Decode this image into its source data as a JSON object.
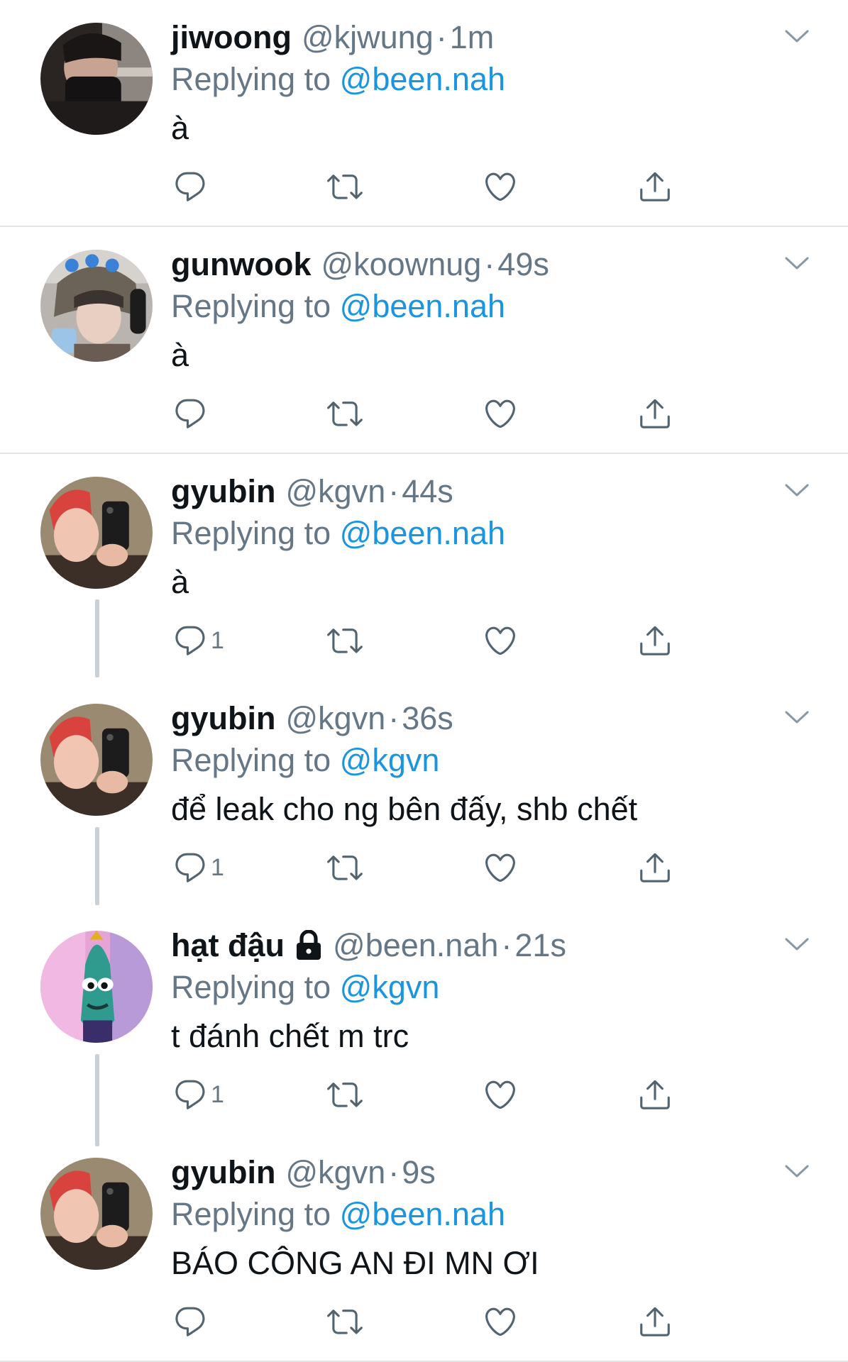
{
  "icons": {
    "reply": "reply-icon",
    "retweet": "retweet-icon",
    "like": "heart-icon",
    "share": "share-icon",
    "caret": "chevron-down-icon",
    "lock": "lock-icon"
  },
  "colors": {
    "link": "#1b95e0",
    "muted": "#657786",
    "text": "#0f1419",
    "icon": "#536471",
    "divider": "#e3e6e8",
    "thread": "#c9d1d8"
  },
  "replying_prefix": "Replying to ",
  "separator": "·",
  "tweets": [
    {
      "name": "jiwoong",
      "handle": "@kjwung",
      "time": "1m",
      "replying_to": "@been.nah",
      "text": "à",
      "reply_count": ""
    },
    {
      "name": "gunwook",
      "handle": "@koownug",
      "time": "49s",
      "replying_to": "@been.nah",
      "text": "à",
      "reply_count": ""
    },
    {
      "name": "gyubin",
      "handle": "@kgvn",
      "time": "44s",
      "replying_to": "@been.nah",
      "text": "à",
      "reply_count": "1"
    },
    {
      "name": "gyubin",
      "handle": "@kgvn",
      "time": "36s",
      "replying_to": "@kgvn",
      "text": "để leak cho ng bên đấy, shb chết",
      "reply_count": "1"
    },
    {
      "name": "hạt đậu",
      "handle": "@been.nah",
      "time": "21s",
      "replying_to": "@kgvn",
      "text": "t đánh chết m trc",
      "reply_count": "1"
    },
    {
      "name": "gyubin",
      "handle": "@kgvn",
      "time": "9s",
      "replying_to": "@been.nah",
      "text": "BÁO CÔNG AN ĐI MN ƠI",
      "reply_count": ""
    }
  ]
}
